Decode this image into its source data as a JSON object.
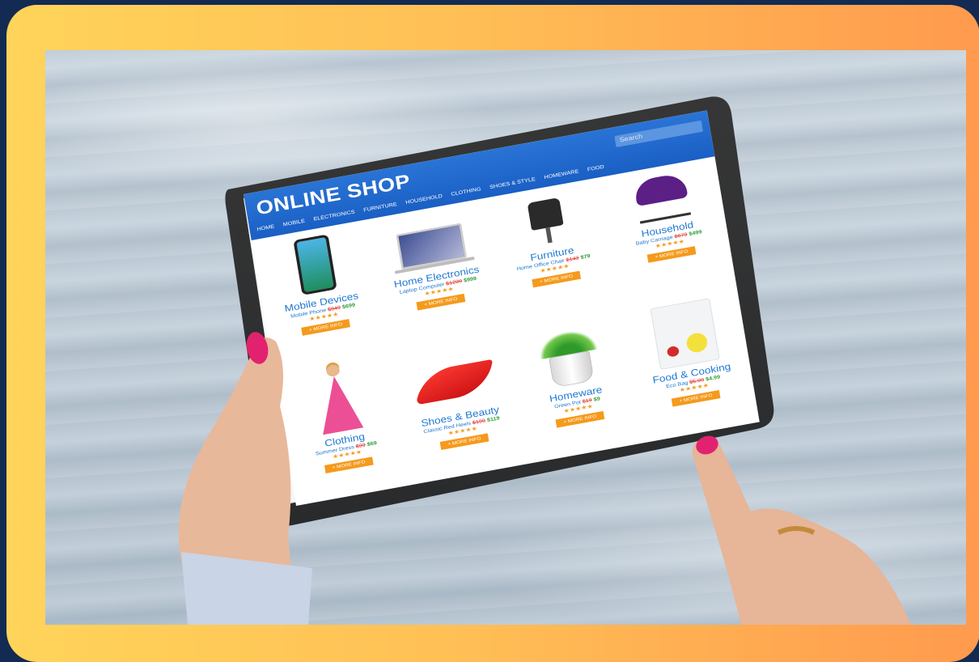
{
  "shop": {
    "title": "ONLINE SHOP",
    "nav": [
      "HOME",
      "MOBILE",
      "ELECTRONICS",
      "FURNITURE",
      "HOUSEHOLD",
      "CLOTHING",
      "SHOES & STYLE",
      "HOMEWARE",
      "FOOD"
    ],
    "search_placeholder": "Search",
    "button_label": "+ MORE INFO",
    "stars": "★★★★★",
    "products": [
      {
        "category": "Mobile Devices",
        "item": "Mobile Phone",
        "old_price": "$849",
        "price": "$699"
      },
      {
        "category": "Home Electronics",
        "item": "Laptop Computer",
        "old_price": "$1299",
        "price": "$999"
      },
      {
        "category": "Furniture",
        "item": "Home Office Chair",
        "old_price": "$149",
        "price": "$79"
      },
      {
        "category": "Household",
        "item": "Baby Carriage",
        "old_price": "$679",
        "price": "$499"
      },
      {
        "category": "Clothing",
        "item": "Summer Dress",
        "old_price": "$99",
        "price": "$69"
      },
      {
        "category": "Shoes & Beauty",
        "item": "Classic Red Heels",
        "old_price": "$199",
        "price": "$119"
      },
      {
        "category": "Homeware",
        "item": "Green Pot",
        "old_price": "$19",
        "price": "$9"
      },
      {
        "category": "Food & Cooking",
        "item": "Eco Bag",
        "old_price": "$5.99",
        "price": "$4.99"
      }
    ]
  },
  "colors": {
    "frame_left": "#ffd45a",
    "frame_right": "#ff9a4e",
    "header_blue": "#1a5fc4",
    "button_orange": "#f59a1c",
    "category_blue": "#1f78d1",
    "old_price_red": "#e0302a",
    "price_green": "#2e9e33",
    "nail_pink": "#e2226f"
  }
}
